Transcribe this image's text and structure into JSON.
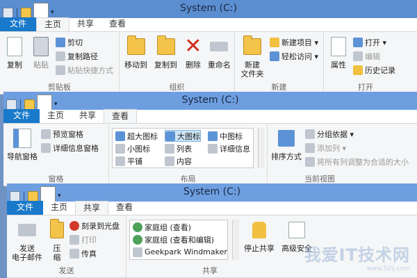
{
  "window_title": "System (C:)",
  "win1": {
    "tabs": [
      "文件",
      "主页",
      "共享",
      "查看"
    ],
    "active_tab": 1,
    "groups": {
      "clipboard": {
        "name": "剪贴板",
        "copy": "复制",
        "paste": "粘贴",
        "cut": "剪切",
        "copy_path": "复制路径",
        "paste_shortcut": "粘贴快捷方式"
      },
      "organize": {
        "name": "组织",
        "move_to": "移动到",
        "copy_to": "复制到",
        "delete": "删除",
        "rename": "重命名"
      },
      "new": {
        "name": "新建",
        "new_folder": "新建\n文件夹",
        "new_item": "新建项目 ▾",
        "easy_access": "轻松访问 ▾"
      },
      "open": {
        "name": "打开",
        "properties": "属性",
        "open": "打开 ▾",
        "edit": "编辑",
        "history": "历史记录"
      }
    }
  },
  "win2": {
    "tabs": [
      "文件",
      "主页",
      "共享",
      "查看"
    ],
    "active_tab": 3,
    "groups": {
      "panes": {
        "name": "窗格",
        "nav_pane": "导航窗格",
        "preview_pane": "预览窗格",
        "details_pane": "详细信息窗格"
      },
      "layout": {
        "name": "布局",
        "items": [
          "超大图标",
          "大图标",
          "中图标",
          "小图标",
          "列表",
          "详细信息",
          "平铺",
          "内容"
        ]
      },
      "current_view": {
        "name": "当前视图",
        "sort_by": "排序方式",
        "group_by": "分组依据 ▾",
        "add_column": "添加列 ▾",
        "fit_columns": "将所有列调整为合适的大小"
      }
    }
  },
  "win3": {
    "tabs": [
      "文件",
      "主页",
      "共享",
      "查看"
    ],
    "active_tab": 2,
    "groups": {
      "send": {
        "name": "发送",
        "email": "发送\n电子邮件",
        "zip": "压\n缩",
        "burn": "刻录到光盘",
        "print": "打印",
        "fax": "传真"
      },
      "share_with": {
        "name": "共享",
        "items": [
          "家庭组 (查看)",
          "家庭组 (查看和编辑)",
          "Geekpark Windmaker"
        ],
        "stop_sharing": "停止共享",
        "advanced": "高级安全"
      }
    }
  },
  "watermark": {
    "line1": "我爱IT技术网",
    "line2": "www.52ij.com"
  }
}
